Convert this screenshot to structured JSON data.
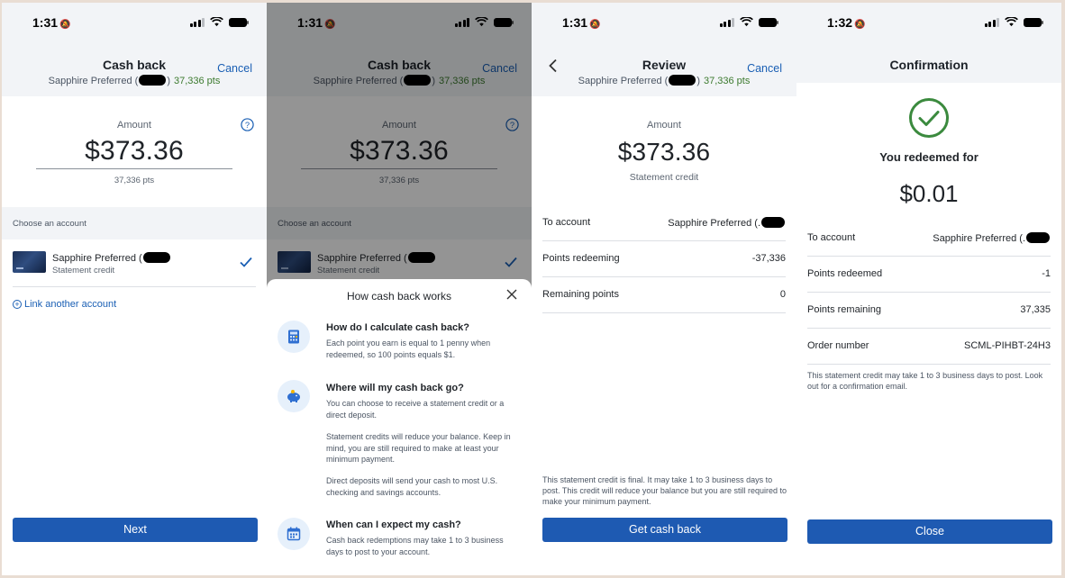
{
  "screens": [
    {
      "status": {
        "time": "1:31"
      },
      "header": {
        "title": "Cash back",
        "account": "Sapphire Preferred (",
        "account_close": ")",
        "points": "37,336 pts",
        "cancel": "Cancel"
      },
      "amount": {
        "label": "Amount",
        "value": "$373.36",
        "points": "37,336 pts"
      },
      "choose_label": "Choose an account",
      "account": {
        "name": "Sapphire Preferred (",
        "type": "Statement credit"
      },
      "link_another": "Link another account",
      "next": "Next"
    },
    {
      "status": {
        "time": "1:31"
      },
      "header": {
        "title": "Cash back",
        "account": "Sapphire Preferred (",
        "account_close": ")",
        "points": "37,336 pts",
        "cancel": "Cancel"
      },
      "amount": {
        "label": "Amount",
        "value": "$373.36",
        "points": "37,336 pts"
      },
      "choose_label": "Choose an account",
      "account": {
        "name": "Sapphire Preferred (",
        "type": "Statement credit"
      },
      "sheet": {
        "title": "How cash back works",
        "faqs": [
          {
            "icon": "calculator-icon",
            "question": "How do I calculate cash back?",
            "answer": "Each point you earn is equal to 1 penny when redeemed, so 100 points equals $1."
          },
          {
            "icon": "piggy-bank-icon",
            "question": "Where will my cash back go?",
            "answer": "You can choose to receive a statement credit or a direct deposit.",
            "answer2": "Statement credits will reduce your balance. Keep in mind, you are still required to make at least your minimum payment.",
            "answer3": "Direct deposits will send your cash to most U.S. checking and savings accounts."
          },
          {
            "icon": "calendar-icon",
            "question": "When can I expect my cash?",
            "answer": "Cash back redemptions may take 1 to 3 business days to post to your account."
          }
        ]
      }
    },
    {
      "status": {
        "time": "1:31"
      },
      "header": {
        "title": "Review",
        "account": "Sapphire Preferred (",
        "account_close": ")",
        "points": "37,336 pts",
        "cancel": "Cancel"
      },
      "amount": {
        "label": "Amount",
        "value": "$373.36",
        "sub": "Statement credit"
      },
      "rows": [
        {
          "label": "To account",
          "value": "Sapphire Preferred (."
        },
        {
          "label": "Points redeeming",
          "value": "-37,336"
        },
        {
          "label": "Remaining points",
          "value": "0"
        }
      ],
      "disclaimer": "This statement credit is final. It may take 1 to 3 business days to post. This credit will reduce your balance but you are still required to make your minimum payment.",
      "button": "Get cash back"
    },
    {
      "status": {
        "time": "1:32"
      },
      "header": {
        "title": "Confirmation"
      },
      "redeemed_label": "You redeemed for",
      "redeemed_amount": "$0.01",
      "rows": [
        {
          "label": "To account",
          "value": "Sapphire Preferred (."
        },
        {
          "label": "Points redeemed",
          "value": "-1"
        },
        {
          "label": "Points remaining",
          "value": "37,335"
        },
        {
          "label": "Order number",
          "value": "SCML-PIHBT-24H3"
        }
      ],
      "note": "This statement credit may take 1 to 3 business days to post. Look out for a confirmation email.",
      "button": "Close"
    }
  ],
  "colors": {
    "primary": "#1e5ab2",
    "link": "#1a5fb4",
    "points_green": "#3c7a2e",
    "success_green": "#3b8a3e",
    "header_bg": "#f2f4f7"
  }
}
